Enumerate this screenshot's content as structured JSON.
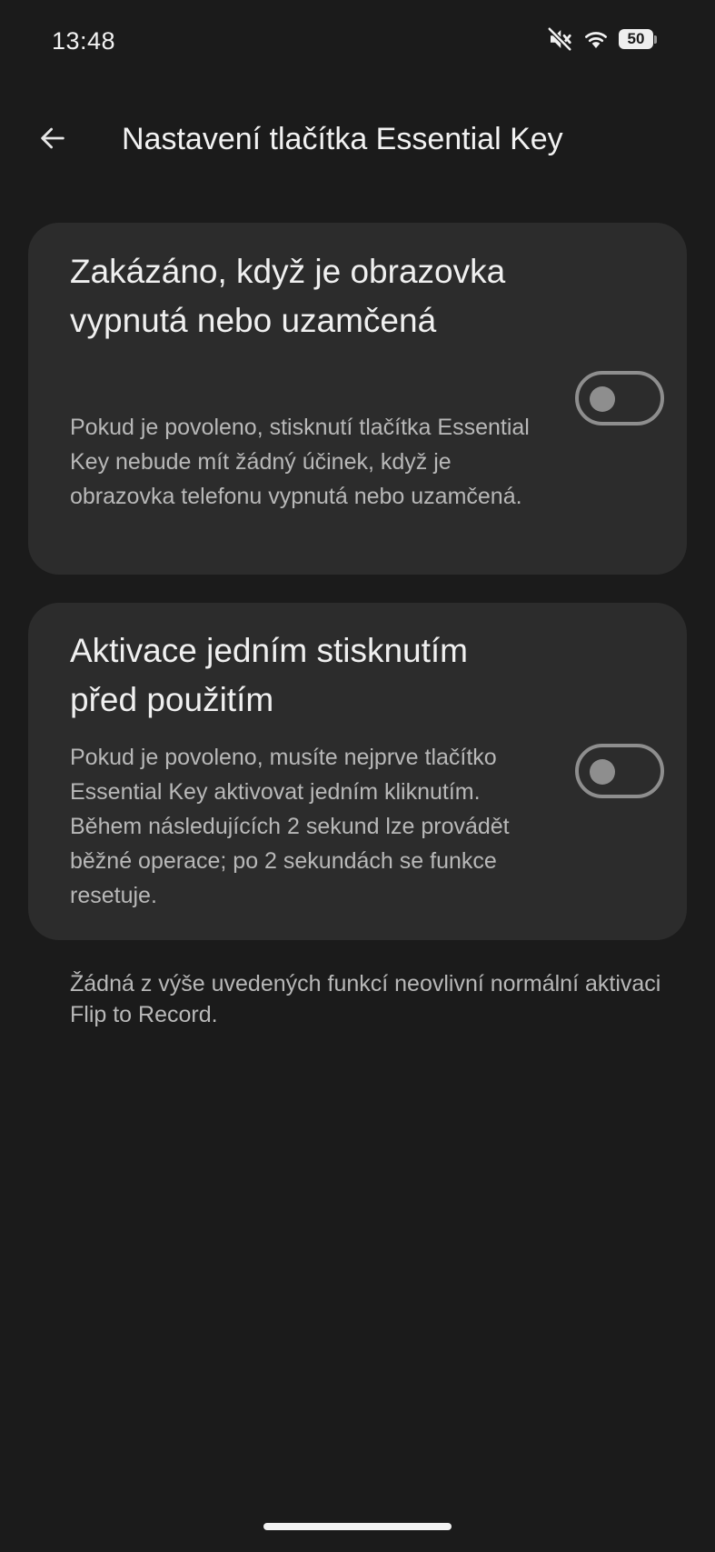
{
  "status_bar": {
    "time": "13:48",
    "battery_level": "50",
    "icons": [
      "mute-icon",
      "wifi-icon",
      "battery-icon"
    ]
  },
  "app_bar": {
    "back_icon": "arrow-left-icon",
    "title": "Nastavení tlačítka Essential Key"
  },
  "settings": [
    {
      "title": "Zakázáno, když je obrazovka vypnutá nebo uzamčená",
      "description": "Pokud je povoleno, stisknutí tlačítka Essential Key nebude mít žádný účinek, když je obrazovka telefonu vypnutá nebo uzamčená.",
      "enabled": false
    },
    {
      "title": "Aktivace jedním stisknutím před použitím",
      "description": "Pokud je povoleno, musíte nejprve tlačítko Essential Key aktivovat jedním kliknutím. Během následujících 2 sekund lze provádět běžné operace; po 2 sekundách se funkce resetuje.",
      "enabled": false
    }
  ],
  "footer_note": "Žádná z výše uvedených funkcí neovlivní normální aktivaci Flip to Record.",
  "colors": {
    "background": "#1b1b1b",
    "card": "#2c2c2c",
    "switch_off": "#8e8e8e"
  }
}
